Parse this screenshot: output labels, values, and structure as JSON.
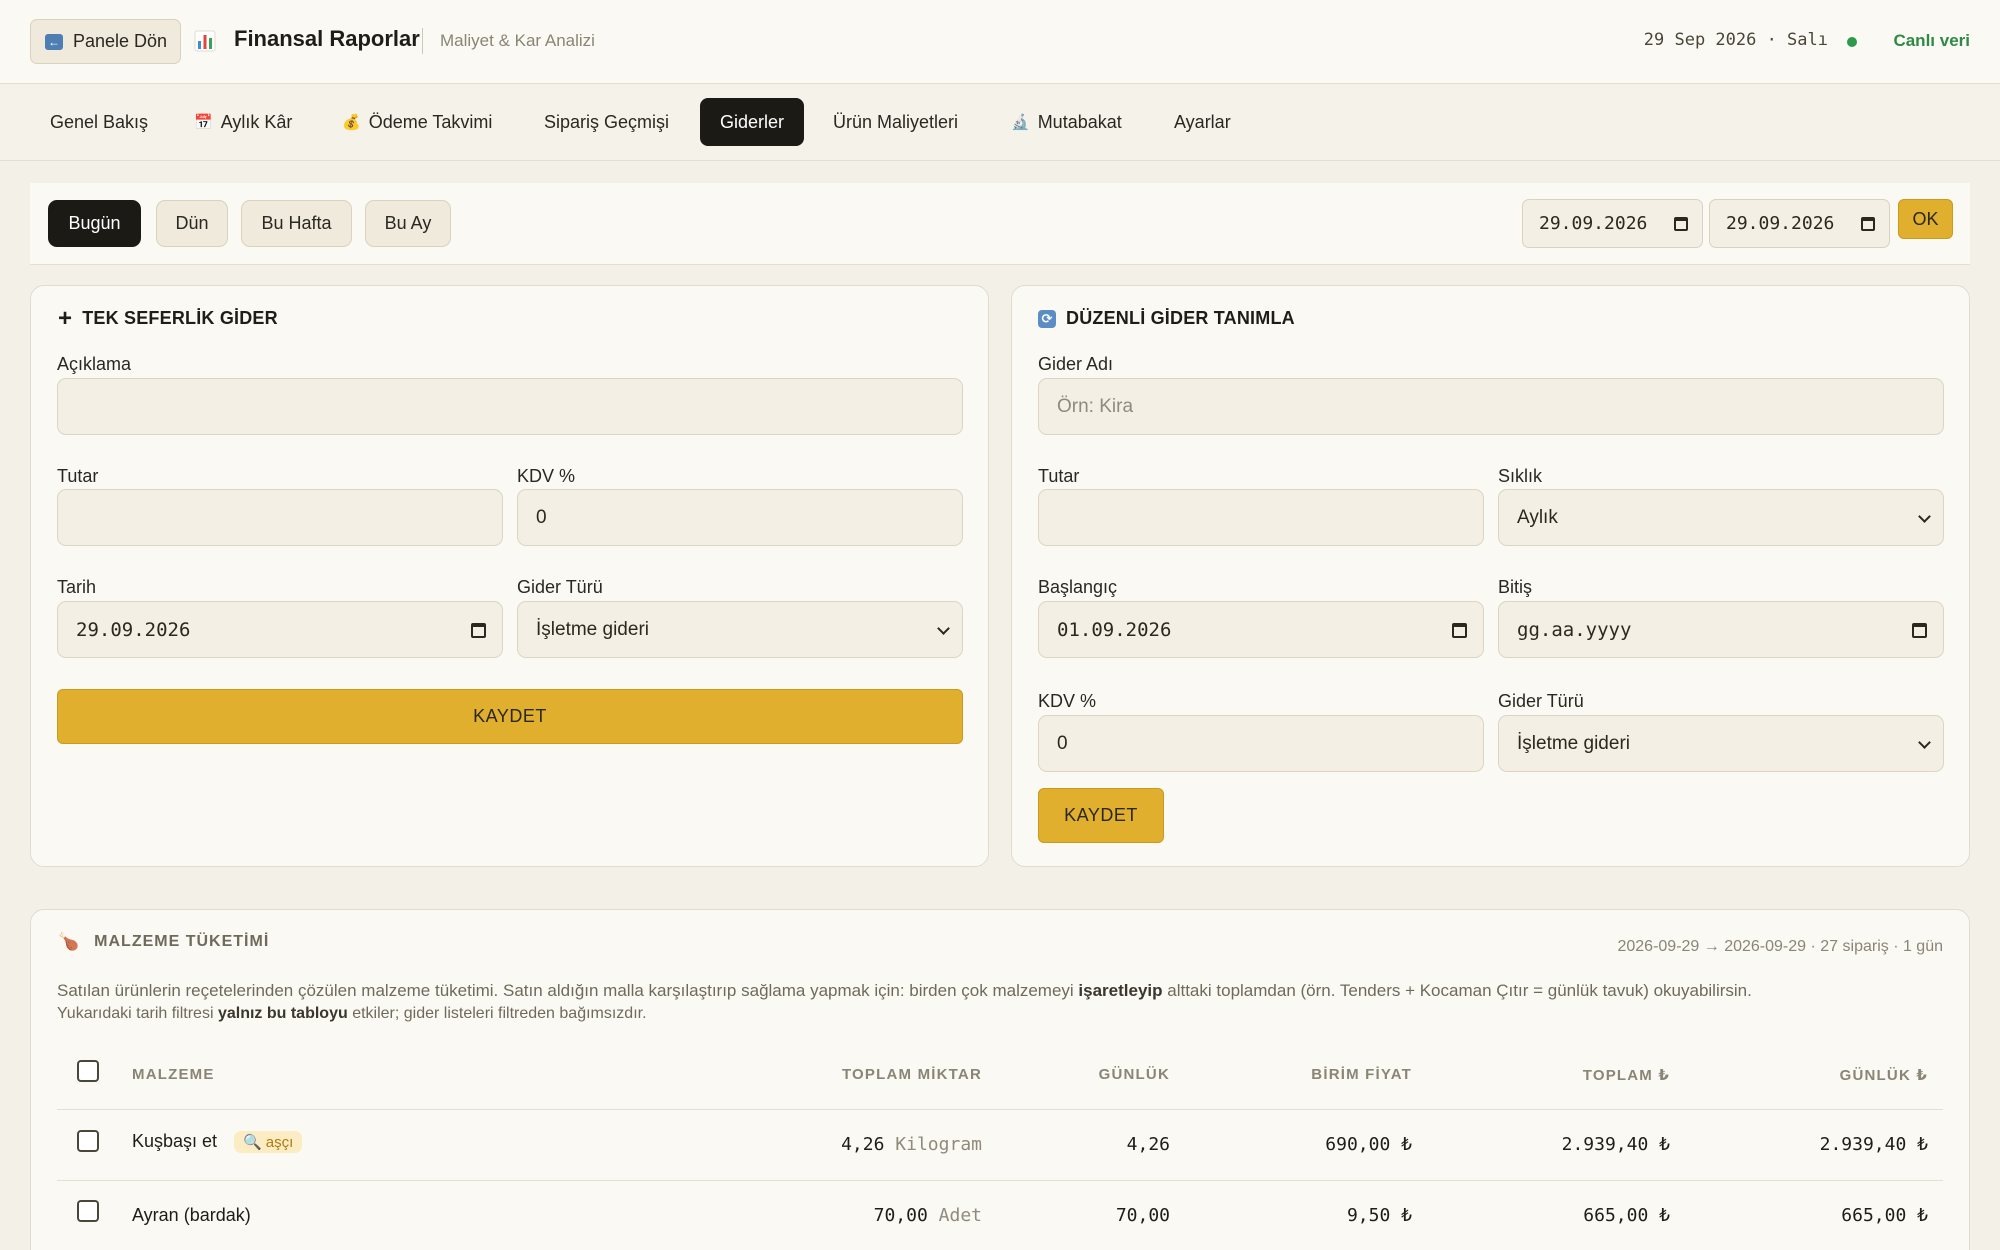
{
  "header": {
    "back_label": "Panele Dön",
    "title": "Finansal Raporlar",
    "subtitle": "Maliyet & Kar Analizi",
    "date": "29 Sep 2026 · Salı",
    "live_label": "Canlı veri",
    "icons": [
      "back-arrow-icon",
      "bar-chart-icon",
      "live-dot-icon"
    ]
  },
  "tabs": [
    {
      "label": "Genel Bakış",
      "icon": ""
    },
    {
      "label": "Aylık Kâr",
      "icon": "calendar-icon"
    },
    {
      "label": "Ödeme Takvimi",
      "icon": "money-bag-icon"
    },
    {
      "label": "Sipariş Geçmişi",
      "icon": ""
    },
    {
      "label": "Giderler",
      "icon": "",
      "active": true
    },
    {
      "label": "Ürün Maliyetleri",
      "icon": ""
    },
    {
      "label": "Mutabakat",
      "icon": "microscope-icon"
    },
    {
      "label": "Ayarlar",
      "icon": ""
    }
  ],
  "filter": {
    "ranges": [
      "Bugün",
      "Dün",
      "Bu Hafta",
      "Bu Ay"
    ],
    "active_range": "Bugün",
    "start_date": "29.09.2026",
    "end_date": "29.09.2026",
    "ok_label": "OK"
  },
  "one_time": {
    "title": "TEK SEFERLİK GİDER",
    "description_label": "Açıklama",
    "description_value": "",
    "amount_label": "Tutar",
    "amount_value": "",
    "vat_label": "KDV %",
    "vat_value": "0",
    "date_label": "Tarih",
    "date_value": "29.09.2026",
    "type_label": "Gider Türü",
    "type_value": "İşletme gideri",
    "save_label": "KAYDET"
  },
  "recurring": {
    "title": "DÜZENLİ GİDER TANIMLA",
    "name_label": "Gider Adı",
    "name_placeholder": "Örn: Kira",
    "amount_label": "Tutar",
    "amount_value": "",
    "frequency_label": "Sıklık",
    "frequency_value": "Aylık",
    "start_label": "Başlangıç",
    "start_value": "01.09.2026",
    "end_label": "Bitiş",
    "end_placeholder": "gg.aa.yyyy",
    "vat_label": "KDV %",
    "vat_value": "0",
    "type_label": "Gider Türü",
    "type_value": "İşletme gideri",
    "save_label": "KAYDET"
  },
  "consumption": {
    "title": "MALZEME TÜKETİMİ",
    "meta": "2026-09-29 → 2026-09-29 · 27 sipariş · 1 gün",
    "desc_part1": "Satılan ürünlerin reçetelerinden çözülen malzeme tüketimi. Satın aldığın malla karşılaştırıp sağlama yapmak için: birden çok malzemeyi ",
    "desc_bold": "işaretleyip",
    "desc_part2": " alttaki toplamdan (örn. Tenders + Kocaman Çıtır = günlük tavuk) okuyabilirsin.",
    "desc2_part1": "Yukarıdaki tarih filtresi ",
    "desc2_bold": "yalnız bu tabloyu",
    "desc2_part2": " etkiler; gider listeleri filtreden bağımsızdır.",
    "columns": [
      "MALZEME",
      "TOPLAM MİKTAR",
      "GÜNLÜK",
      "BİRİM FİYAT",
      "TOPLAM ₺",
      "GÜNLÜK ₺"
    ],
    "rows": [
      {
        "name": "Kuşbaşı et",
        "badge": "aşçı",
        "qty": "4,26",
        "unit": "Kilogram",
        "daily": "4,26",
        "unit_price": "690,00 ₺",
        "total": "2.939,40 ₺",
        "daily_total": "2.939,40 ₺"
      },
      {
        "name": "Ayran (bardak)",
        "badge": "",
        "qty": "70,00",
        "unit": "Adet",
        "daily": "70,00",
        "unit_price": "9,50 ₺",
        "total": "665,00 ₺",
        "daily_total": "665,00 ₺"
      }
    ]
  },
  "colors": {
    "accent": "#e0af2e",
    "dark": "#1c1a15",
    "live": "#2e8a45",
    "background": "#f3f0e7"
  }
}
